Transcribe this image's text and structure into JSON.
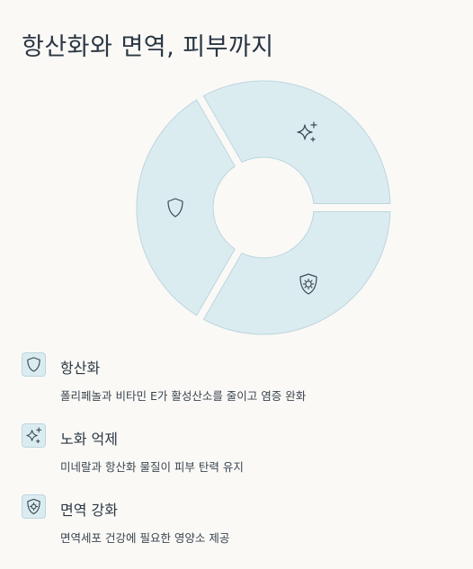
{
  "title": "항산화와 면역, 피부까지",
  "colors": {
    "segment_fill": "#dbecf1",
    "segment_stroke": "#bcd5de",
    "text": "#2b3744",
    "background": "#faf9f6"
  },
  "segments": [
    {
      "id": "antioxidant",
      "icon": "shield-icon"
    },
    {
      "id": "anti-aging",
      "icon": "sparkles-icon"
    },
    {
      "id": "immunity",
      "icon": "shield-gear-icon"
    }
  ],
  "legend": [
    {
      "icon": "shield-icon",
      "title": "항산화",
      "description": "폴리페놀과 비타민 E가 활성산소를 줄이고 염증 완화"
    },
    {
      "icon": "sparkles-icon",
      "title": "노화 억제",
      "description": "미네랄과 항산화 물질이 피부 탄력 유지"
    },
    {
      "icon": "shield-gear-icon",
      "title": "면역 강화",
      "description": "면역세포 건강에 필요한 영양소 제공"
    }
  ]
}
